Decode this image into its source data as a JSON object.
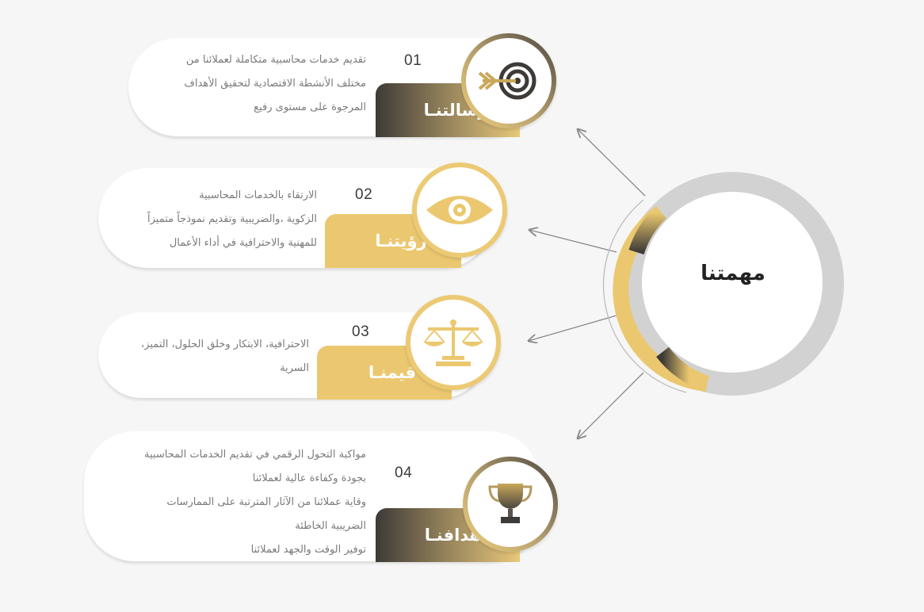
{
  "hub": {
    "title": "مهمتنا"
  },
  "items": [
    {
      "number": "01",
      "title": "رسالتنـا",
      "icon": "target-arrow-icon",
      "description": [
        "تقديم خدمات محاسبية متكاملة لعملائنا من",
        "مختلف الأنشطة الاقتصادية لتحقيق الأهداف",
        "المرجوة على مستوى رفيع"
      ]
    },
    {
      "number": "02",
      "title": "رؤيتنـا",
      "icon": "eye-icon",
      "description": [
        "الارتقاء بالخدمات المحاسبية",
        "الزكوية ،والضريبية وتقديم نموذجاً متميزاً",
        "للمهنية والاحترافية في أداء الأعمال"
      ]
    },
    {
      "number": "03",
      "title": "قيمنـا",
      "icon": "scales-icon",
      "description": [
        "الاحترافية، الابتكار وخلق الحلول، التميز،",
        "السرية"
      ]
    },
    {
      "number": "04",
      "title": "أهدافنـا",
      "icon": "trophy-icon",
      "description": [
        "مواكبة التحول الرقمي في تقديم الخدمات المحاسبية",
        "بجودة وكفاءة عالية لعملائنا",
        "وقاية عملائنا من الآثار المترتبة على الممارسات",
        "الضريبية الخاطئة",
        "توفير الوقت والجهد لعملائنا"
      ]
    }
  ],
  "colors": {
    "gold": "#ebc870",
    "dark": "#3d3a37",
    "ring_gray": "#cfcfcf",
    "text": "#7a7a7a"
  }
}
